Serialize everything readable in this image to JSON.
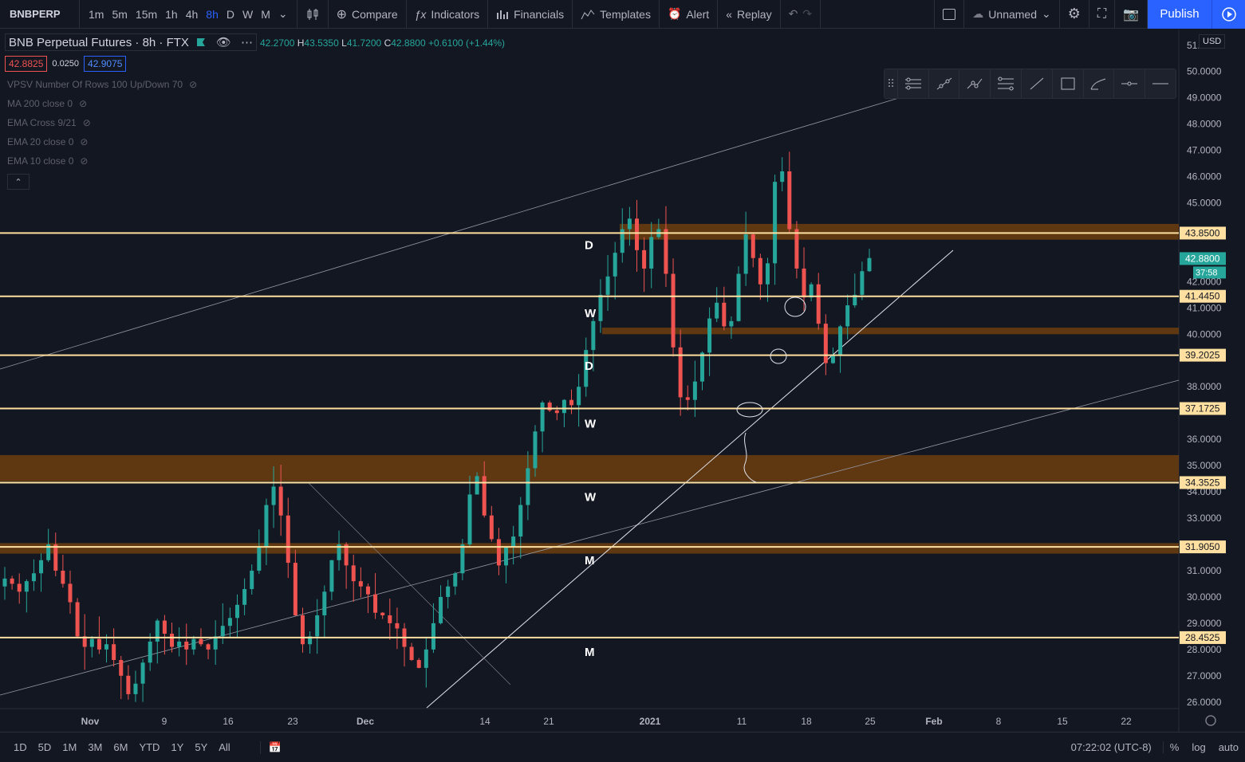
{
  "toolbar": {
    "symbol": "BNBPERP",
    "intervals": [
      "1m",
      "5m",
      "15m",
      "1h",
      "4h",
      "8h",
      "D",
      "W",
      "M"
    ],
    "active_interval": "8h",
    "compare": "Compare",
    "indicators": "Indicators",
    "financials": "Financials",
    "templates": "Templates",
    "alert": "Alert",
    "replay": "Replay",
    "layout_name": "Unnamed",
    "publish": "Publish"
  },
  "legend": {
    "title": "BNB Perpetual Futures · 8h · FTX",
    "ohlc": {
      "O": "42.2700",
      "H": "43.5350",
      "L": "41.7200",
      "C": "42.8800",
      "change": "+0.6100 (+1.44%)"
    },
    "bid": "42.8825",
    "spread": "0.0250",
    "ask": "42.9075",
    "indicators": [
      "VPSV Number Of Rows 100 Up/Down 70",
      "MA 200 close 0",
      "EMA Cross 9/21",
      "EMA 20 close 0",
      "EMA 10 close 0"
    ]
  },
  "currency": "USD",
  "chart_data": {
    "type": "candlestick",
    "price_axis": [
      "51.0000",
      "50.0000",
      "49.0000",
      "48.0000",
      "47.0000",
      "46.0000",
      "45.0000",
      "42.0000",
      "41.0000",
      "40.0000",
      "38.0000",
      "36.0000",
      "35.0000",
      "34.0000",
      "33.0000",
      "32.0000",
      "31.0000",
      "30.0000",
      "29.0000",
      "28.0000",
      "27.0000",
      "26.0000"
    ],
    "price_ticks": [
      51,
      50,
      49,
      48,
      47,
      46,
      45,
      42,
      41,
      40,
      38,
      36,
      35,
      34,
      33,
      32,
      31,
      30,
      29,
      28,
      27,
      26
    ],
    "y_range": [
      25.75,
      51.6
    ],
    "time_axis": [
      "Nov",
      "9",
      "16",
      "23",
      "Dec",
      "14",
      "21",
      "2021",
      "11",
      "18",
      "25",
      "Feb",
      "8",
      "15",
      "22"
    ],
    "horizontal_levels": [
      {
        "price": 43.85,
        "label": "43.8500"
      },
      {
        "price": 41.445,
        "label": "41.4450"
      },
      {
        "price": 39.2025,
        "label": "39.2025"
      },
      {
        "price": 37.1725,
        "label": "37.1725"
      },
      {
        "price": 34.3525,
        "label": "34.3525"
      },
      {
        "price": 31.905,
        "label": "31.9050"
      },
      {
        "price": 28.4525,
        "label": "28.4525"
      }
    ],
    "zones": [
      {
        "from": 43.6,
        "to": 44.2
      },
      {
        "from": 40.0,
        "to": 40.25
      },
      {
        "from": 34.4,
        "to": 35.4
      },
      {
        "from": 31.65,
        "to": 32.05
      }
    ],
    "annotations": [
      {
        "text": "D",
        "price": 43.4
      },
      {
        "text": "W",
        "price": 40.8
      },
      {
        "text": "D",
        "price": 38.8
      },
      {
        "text": "W",
        "price": 36.6
      },
      {
        "text": "W",
        "price": 33.8
      },
      {
        "text": "M",
        "price": 31.4
      },
      {
        "text": "M",
        "price": 27.9
      }
    ],
    "last_price": {
      "label": "42.8800",
      "countdown": "37:58"
    },
    "closes": [
      30.7,
      30.5,
      30.2,
      30.6,
      30.9,
      31.4,
      32.0,
      31.0,
      30.5,
      29.8,
      28.5,
      28.1,
      28.4,
      28.0,
      28.2,
      27.6,
      27.0,
      26.3,
      26.7,
      27.5,
      28.3,
      29.1,
      28.6,
      28.1,
      28.3,
      28.0,
      28.4,
      28.2,
      28.0,
      28.5,
      28.9,
      29.2,
      29.7,
      30.3,
      31.0,
      31.9,
      33.5,
      34.2,
      33.1,
      31.3,
      29.3,
      28.2,
      28.5,
      29.3,
      30.2,
      31.4,
      32.0,
      31.2,
      30.6,
      30.4,
      30.1,
      29.4,
      29.3,
      29.0,
      28.8,
      28.1,
      27.6,
      27.3,
      28.0,
      29.0,
      30.0,
      30.4,
      30.9,
      32.0,
      33.9,
      34.6,
      33.1,
      32.2,
      31.2,
      31.9,
      32.3,
      33.5,
      34.9,
      36.3,
      37.4,
      37.1,
      37.0,
      37.5,
      37.3,
      38.0,
      39.4,
      40.5,
      41.5,
      42.2,
      43.1,
      44.0,
      44.4,
      43.2,
      42.5,
      43.7,
      44.0,
      42.3,
      39.5,
      37.6,
      37.5,
      38.2,
      39.3,
      40.6,
      41.2,
      40.3,
      40.5,
      42.3,
      43.8,
      42.9,
      41.9,
      42.7,
      45.8,
      46.2,
      44.0,
      42.5,
      41.4,
      41.9,
      40.4,
      38.9,
      39.2,
      40.3,
      41.1,
      41.5,
      42.4,
      42.9
    ],
    "last_axis_label": "42.8800"
  },
  "bottom": {
    "ranges": [
      "1D",
      "5D",
      "1M",
      "3M",
      "6M",
      "YTD",
      "1Y",
      "5Y",
      "All"
    ],
    "time": "07:22:02 (UTC-8)",
    "percent": "%",
    "log": "log",
    "auto": "auto"
  }
}
